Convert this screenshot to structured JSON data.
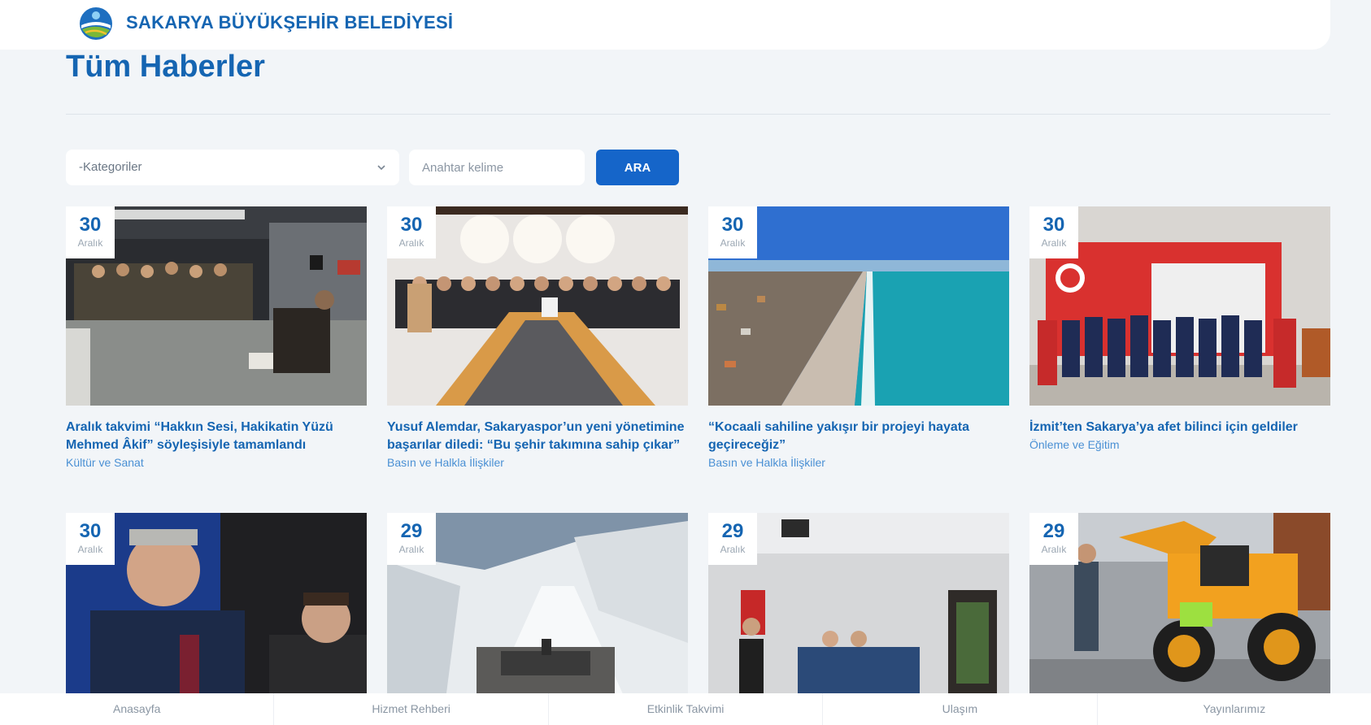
{
  "header": {
    "brand": "SAKARYA BÜYÜKŞEHİR BELEDİYESİ"
  },
  "page": {
    "title": "Tüm Haberler"
  },
  "filters": {
    "category_label": "-Kategoriler",
    "keyword_placeholder": "Anahtar kelime",
    "search_button": "ARA"
  },
  "news": [
    {
      "day": "30",
      "month": "Aralık",
      "title": "Aralık takvimi “Hakkın Sesi, Hakikatin Yüzü Mehmed Âkif” söyleşisiyle tamamlandı",
      "category": "Kültür ve Sanat"
    },
    {
      "day": "30",
      "month": "Aralık",
      "title": "Yusuf Alemdar, Sakaryaspor’un yeni yönetimine başarılar diledi: “Bu şehir takımına sahip çıkar”",
      "category": "Basın ve Halkla İlişkiler"
    },
    {
      "day": "30",
      "month": "Aralık",
      "title": "“Kocaali sahiline yakışır bir projeyi hayata geçireceğiz”",
      "category": "Basın ve Halkla İlişkiler"
    },
    {
      "day": "30",
      "month": "Aralık",
      "title": "İzmit’ten Sakarya’ya afet bilinci için geldiler",
      "category": "Önleme ve Eğitim"
    },
    {
      "day": "30",
      "month": "Aralık"
    },
    {
      "day": "29",
      "month": "Aralık"
    },
    {
      "day": "29",
      "month": "Aralık"
    },
    {
      "day": "29",
      "month": "Aralık"
    }
  ],
  "footer": {
    "items": [
      "Anasayfa",
      "Hizmet Rehberi",
      "Etkinlik Takvimi",
      "Ulaşım",
      "Yayınlarımız"
    ]
  }
}
